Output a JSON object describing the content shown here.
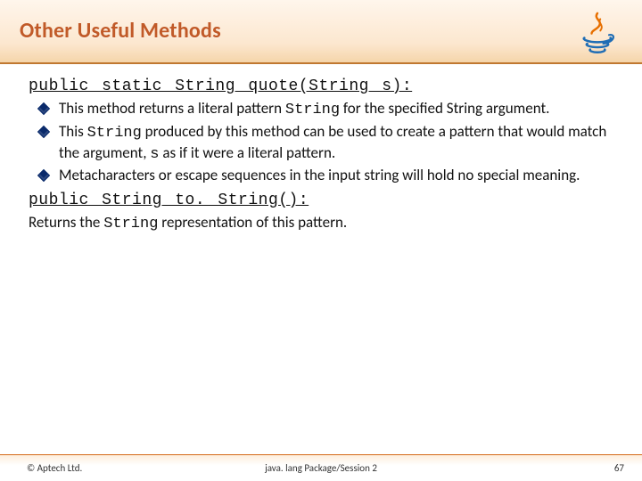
{
  "header": {
    "title": "Other Useful Methods"
  },
  "section1": {
    "signature": "public static String quote(String s):",
    "bullets": [
      {
        "pre": "This method returns a literal pattern ",
        "code": "String",
        "post": " for the specified String argument."
      },
      {
        "pre": "This ",
        "code": "String",
        "post": " produced by this method can be used to create a pattern that would match the argument, ",
        "code2": "s",
        "post2": " as if it were a literal pattern."
      },
      {
        "pre": "Metacharacters or escape sequences in the input string will hold no special meaning.",
        "code": "",
        "post": ""
      }
    ]
  },
  "section2": {
    "signature": "public String to. String():",
    "body_pre": "Returns the ",
    "body_code": "String",
    "body_post": " representation of this pattern."
  },
  "footer": {
    "left": "© Aptech Ltd.",
    "center": "java. lang Package/Session 2",
    "right": "67"
  }
}
